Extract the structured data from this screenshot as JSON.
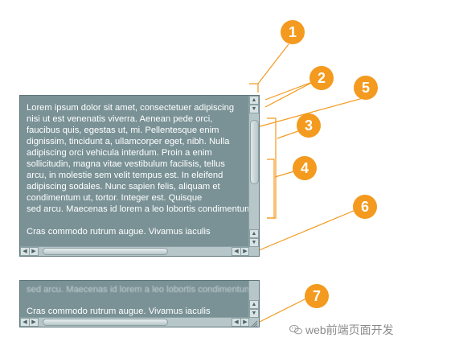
{
  "main_lines": [
    "Lorem ipsum dolor sit amet, consectetuer adipiscing",
    "nisi ut est venenatis viverra. Aenean pede orci,",
    "faucibus quis, egestas ut, mi. Pellentesque enim",
    "dignissim, tincidunt a, ullamcorper eget, nibh. Nulla",
    "adipiscing orci vehicula interdum. Proin a enim",
    "sollicitudin, magna vitae vestibulum facilisis, tellus",
    "arcu, in molestie sem velit tempus est. In eleifend",
    "adipiscing sodales. Nunc sapien felis, aliquam et",
    "condimentum ut, tortor. Integer est. Quisque",
    "sed arcu. Maecenas id lorem a leo lobortis condimentum."
  ],
  "main_last_line": "Cras commodo rutrum augue. Vivamus iaculis",
  "bottom_faded_line": "sed arcu. Maecenas id lorem a leo lobortis condimentum.",
  "bottom_line": "Cras commodo rutrum augue. Vivamus iaculis",
  "markers": [
    "1",
    "2",
    "3",
    "4",
    "5",
    "6",
    "7"
  ],
  "watermark": "web前端页面开发",
  "icons": {
    "up": "triangle-up-icon",
    "down": "triangle-down-icon",
    "left": "triangle-left-icon",
    "right": "triangle-right-icon",
    "resize": "resize-grip-icon",
    "wechat": "wechat-icon"
  },
  "colors": {
    "marker": "#f39a1f",
    "panel": "#7a9296",
    "scroll": "#b7c6c8"
  }
}
